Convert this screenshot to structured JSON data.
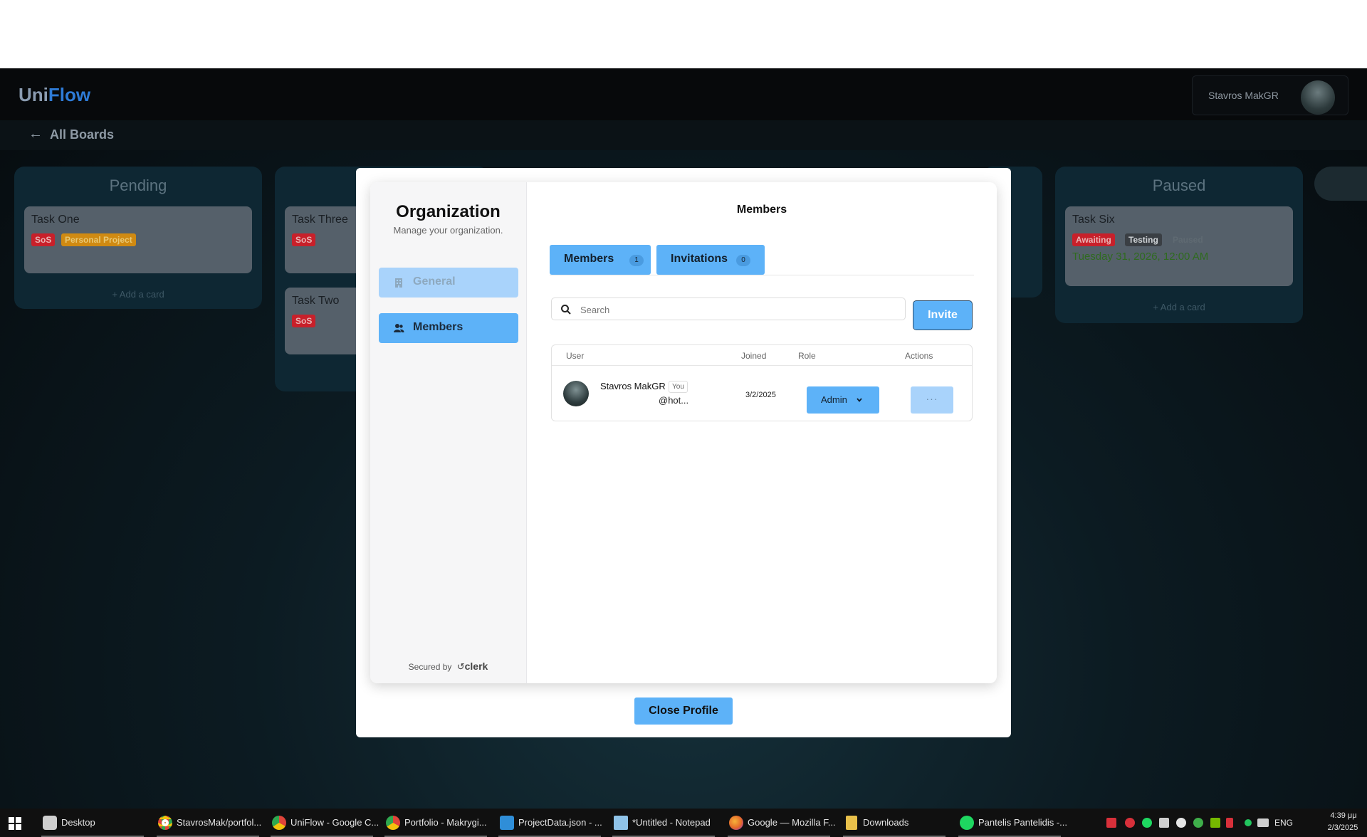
{
  "app": {
    "logo_part1": "Uni",
    "logo_part2": "Flow",
    "profile_name": "Stavros MakGR",
    "back_label": "All Boards"
  },
  "columns": [
    {
      "title": "Pending",
      "add_label": "+ Add a card"
    },
    {
      "title": "Paused",
      "add_label": "+ Add a card"
    }
  ],
  "cards": {
    "task_one": {
      "title": "Task One",
      "tags": [
        "SoS",
        "Personal Project"
      ]
    },
    "task_three": {
      "title": "Task Three",
      "tags": [
        "SoS"
      ]
    },
    "task_two": {
      "title": "Task Two",
      "tags": [
        "SoS"
      ]
    },
    "task_six": {
      "title": "Task Six",
      "tags": [
        "Awaiting",
        "Testing",
        "Paused"
      ],
      "date": "Tuesday 31, 2026, 12:00 AM"
    }
  },
  "org": {
    "title": "Organization",
    "subtitle": "Manage your organization.",
    "nav": [
      {
        "label": "General",
        "icon": "building-icon"
      },
      {
        "label": "Members",
        "icon": "users-icon"
      }
    ],
    "secured_by": "Secured by",
    "secured_brand": "clerk"
  },
  "members_page": {
    "heading": "Members",
    "tabs": [
      {
        "label": "Members",
        "count": "1"
      },
      {
        "label": "Invitations",
        "count": "0"
      }
    ],
    "search_placeholder": "Search",
    "invite_label": "Invite",
    "columns": [
      "User",
      "Joined",
      "Role",
      "Actions"
    ],
    "rows": [
      {
        "name": "Stavros MakGR",
        "badge": "You",
        "email": "@hot...",
        "joined": "3/2/2025",
        "role": "Admin",
        "actions": "···"
      }
    ]
  },
  "close_label": "Close Profile",
  "taskbar": {
    "items": [
      {
        "label": "Desktop",
        "icon": "desktop-icon",
        "color": "#cfcfcf"
      },
      {
        "label": "StavrosMak/portfol...",
        "icon": "chrome-icon",
        "color": "#e0443a"
      },
      {
        "label": "UniFlow - Google C...",
        "icon": "chrome-icon",
        "color": "#e0443a"
      },
      {
        "label": "Portfolio - Makrygi...",
        "icon": "chrome-icon",
        "color": "#e0443a"
      },
      {
        "label": "ProjectData.json - ...",
        "icon": "vscode-icon",
        "color": "#2f8ed8"
      },
      {
        "label": "*Untitled - Notepad",
        "icon": "notepad-icon",
        "color": "#8fc3e8"
      },
      {
        "label": "Google — Mozilla F...",
        "icon": "firefox-icon",
        "color": "#e4692a"
      },
      {
        "label": "Downloads",
        "icon": "folder-icon",
        "color": "#e8c04a"
      },
      {
        "label": "Pantelis Pantelidis -...",
        "icon": "spotify-icon",
        "color": "#1ed760"
      }
    ],
    "lang": "ENG",
    "time": "4:39 μμ",
    "date": "2/3/2025"
  },
  "colors": {
    "accent": "#5db2f8",
    "accent_light": "#a9d3fb",
    "brand_blue": "#2e7bd6",
    "tag_red": "#c8202a",
    "tag_orange": "#d08a12"
  }
}
